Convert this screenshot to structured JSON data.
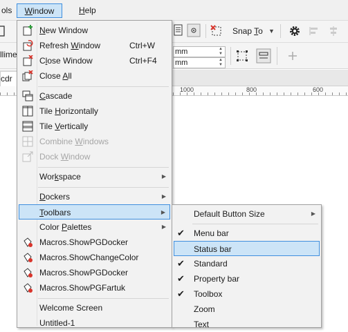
{
  "menubar": {
    "tools_label": "ols",
    "window_label": "Window",
    "window_underline": "W",
    "window_rest": "indow",
    "help_label": "Help",
    "help_underline": "H",
    "help_rest": "elp"
  },
  "toolbar": {
    "snap_to": "Snap To",
    "snap_to_prefix": "Snap ",
    "snap_to_underline": "T",
    "snap_to_rest": "o"
  },
  "property_bar": {
    "unit_top": "mm",
    "unit_bottom": "mm",
    "left_truncated": "llime"
  },
  "document_tab": {
    "label": "cdr"
  },
  "ruler": {
    "labels": [
      "1000",
      "800",
      "600"
    ]
  },
  "window_menu": {
    "items": [
      {
        "label": "New Window",
        "u": "N",
        "rest": "ew Window",
        "icon": "new-window-icon"
      },
      {
        "label": "Refresh Window",
        "pre": "Refresh ",
        "u": "W",
        "rest": "indow",
        "shortcut": "Ctrl+W",
        "icon": "refresh-window-icon"
      },
      {
        "label": "Close Window",
        "pre": "C",
        "u": "l",
        "rest": "ose Window",
        "shortcut": "Ctrl+F4",
        "icon": "close-window-icon"
      },
      {
        "label": "Close All",
        "pre": "Close ",
        "u": "A",
        "rest": "ll",
        "icon": "close-all-icon"
      },
      {
        "label": "Cascade",
        "u": "C",
        "rest": "ascade",
        "icon": "cascade-icon"
      },
      {
        "label": "Tile Horizontally",
        "pre": "Tile ",
        "u": "H",
        "rest": "orizontally",
        "icon": "tile-horizontally-icon"
      },
      {
        "label": "Tile Vertically",
        "pre": "Tile ",
        "u": "V",
        "rest": "ertically",
        "icon": "tile-vertically-icon"
      },
      {
        "label": "Combine Windows",
        "pre": "Combine ",
        "u": "W",
        "rest": "indows",
        "icon": "combine-windows-icon"
      },
      {
        "label": "Dock Window",
        "pre": "Dock ",
        "u": "W",
        "rest": "indow",
        "icon": "dock-window-icon"
      },
      {
        "label": "Workspace",
        "pre": "Wor",
        "u": "k",
        "rest": "space"
      },
      {
        "label": "Dockers",
        "u": "D",
        "rest": "ockers"
      },
      {
        "label": "Toolbars",
        "u": "T",
        "rest": "oolbars"
      },
      {
        "label": "Color Palettes",
        "pre": "Color ",
        "u": "P",
        "rest": "alettes"
      },
      {
        "label": "Macros.ShowPGDocker",
        "icon": "macro-icon"
      },
      {
        "label": "Macros.ShowChangeColor",
        "icon": "macro-icon"
      },
      {
        "label": "Macros.ShowPGDocker",
        "icon": "macro-icon"
      },
      {
        "label": "Macros.ShowPGFartuk",
        "icon": "macro-icon"
      },
      {
        "label": "Welcome Screen"
      },
      {
        "label": "Untitled-1"
      }
    ]
  },
  "toolbars_submenu": {
    "items": [
      {
        "label": "Default Button Size"
      },
      {
        "label": "Menu bar",
        "checked": true
      },
      {
        "label": "Status bar",
        "checked": false
      },
      {
        "label": "Standard",
        "checked": true
      },
      {
        "label": "Property bar",
        "checked": true
      },
      {
        "label": "Toolbox",
        "checked": true
      },
      {
        "label": "Zoom",
        "checked": false
      },
      {
        "label": "Text",
        "checked": false
      }
    ]
  },
  "colors": {
    "highlight_bg": "#cce4f7",
    "highlight_border": "#3e8ede",
    "menu_bg": "#f2f2f2",
    "disabled_text": "#a6a6a6",
    "macro_icon_red": "#d9342b"
  }
}
